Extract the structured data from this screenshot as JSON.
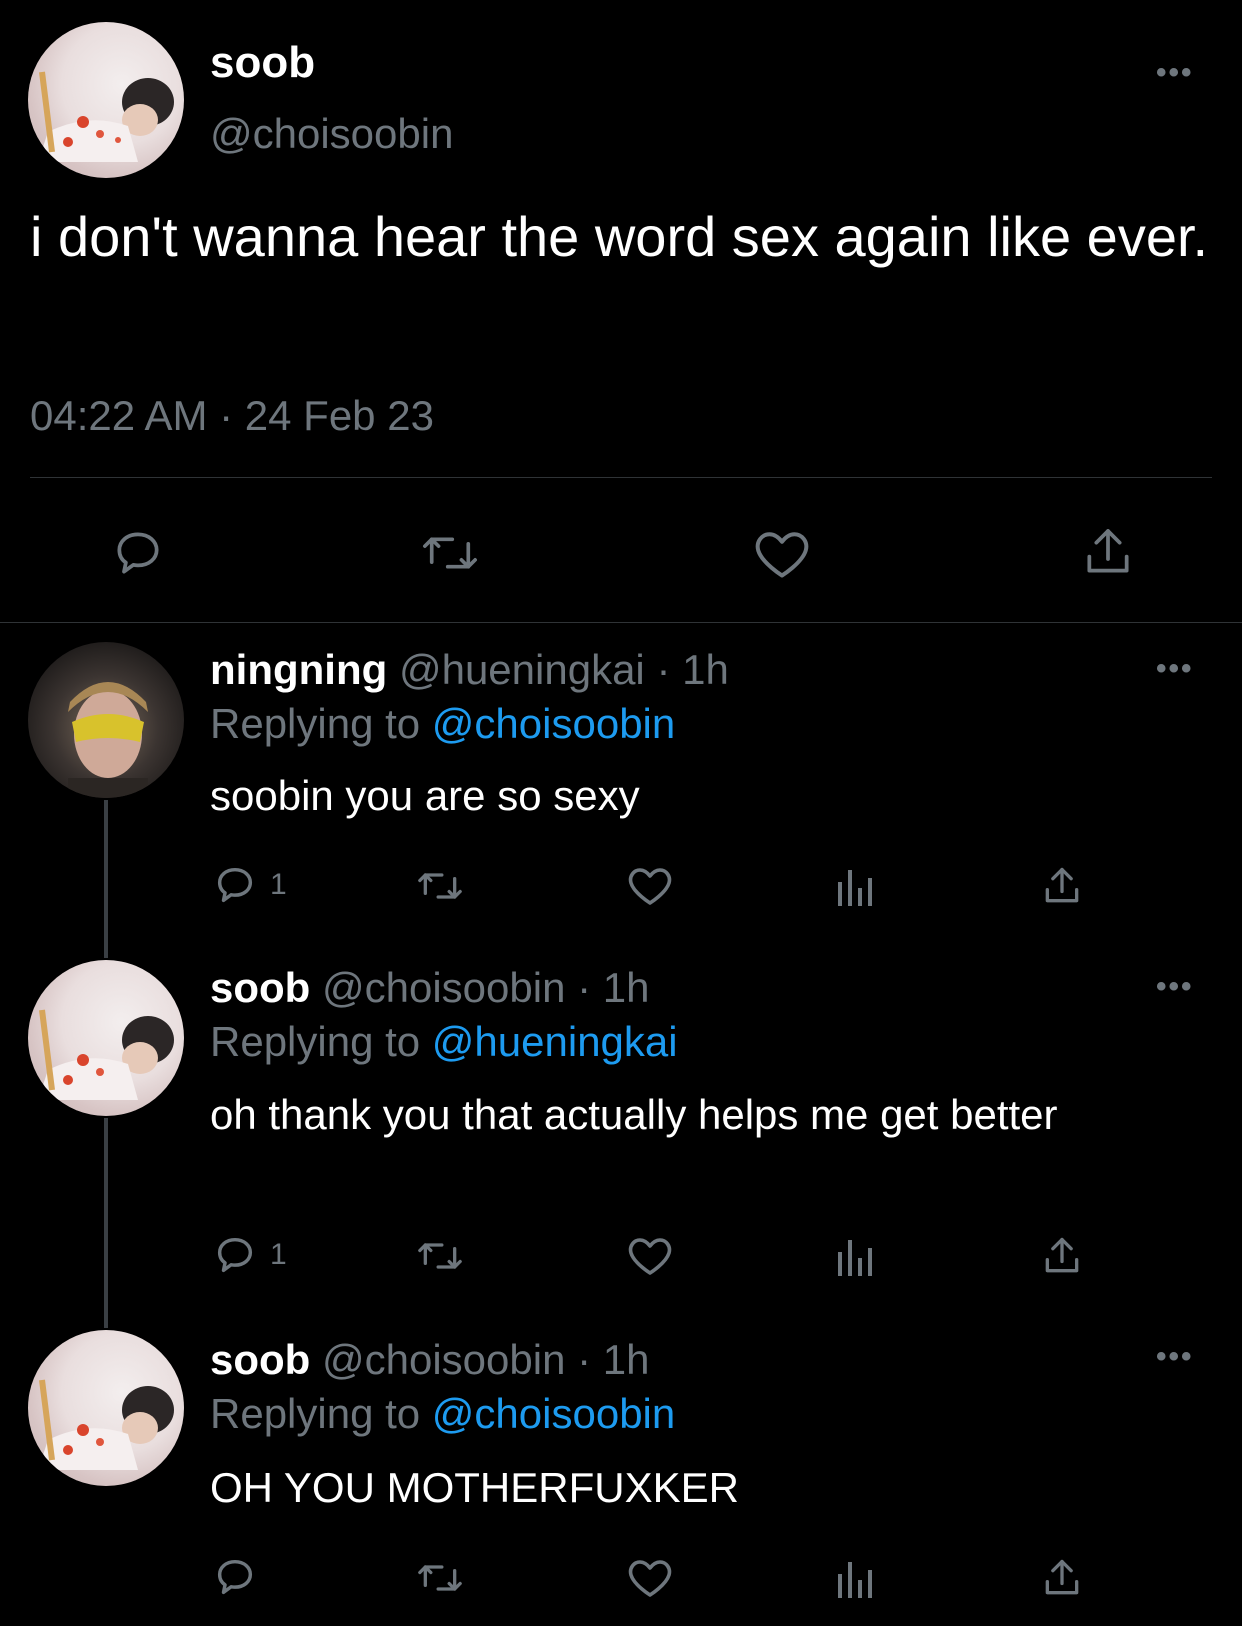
{
  "main_tweet": {
    "display_name": "soob",
    "handle": "@choisoobin",
    "text": "i don't wanna hear the word sex again like ever.",
    "timestamp": "04:22 AM · 24 Feb 23"
  },
  "replies": [
    {
      "display_name": "ningning",
      "handle": "@hueningkai",
      "time": "· 1h",
      "replying_label": "Replying to ",
      "replying_to": "@choisoobin",
      "text": "soobin you are so sexy",
      "reply_count": "1"
    },
    {
      "display_name": "soob",
      "handle": "@choisoobin",
      "time": "· 1h",
      "replying_label": "Replying to ",
      "replying_to": "@hueningkai",
      "text": "oh thank you that actually helps me get better",
      "reply_count": "1"
    },
    {
      "display_name": "soob",
      "handle": "@choisoobin",
      "time": "· 1h",
      "replying_label": "Replying to ",
      "replying_to": "@choisoobin",
      "text": "OH YOU MOTHERFUXKER",
      "reply_count": ""
    }
  ],
  "more_label": "•••",
  "colors": {
    "background": "#000000",
    "text": "#e7e9ea",
    "muted": "#6e767d",
    "link": "#1d9bf0"
  },
  "icons": [
    "comment-icon",
    "retweet-icon",
    "like-icon",
    "analytics-icon",
    "share-icon",
    "more-icon"
  ]
}
